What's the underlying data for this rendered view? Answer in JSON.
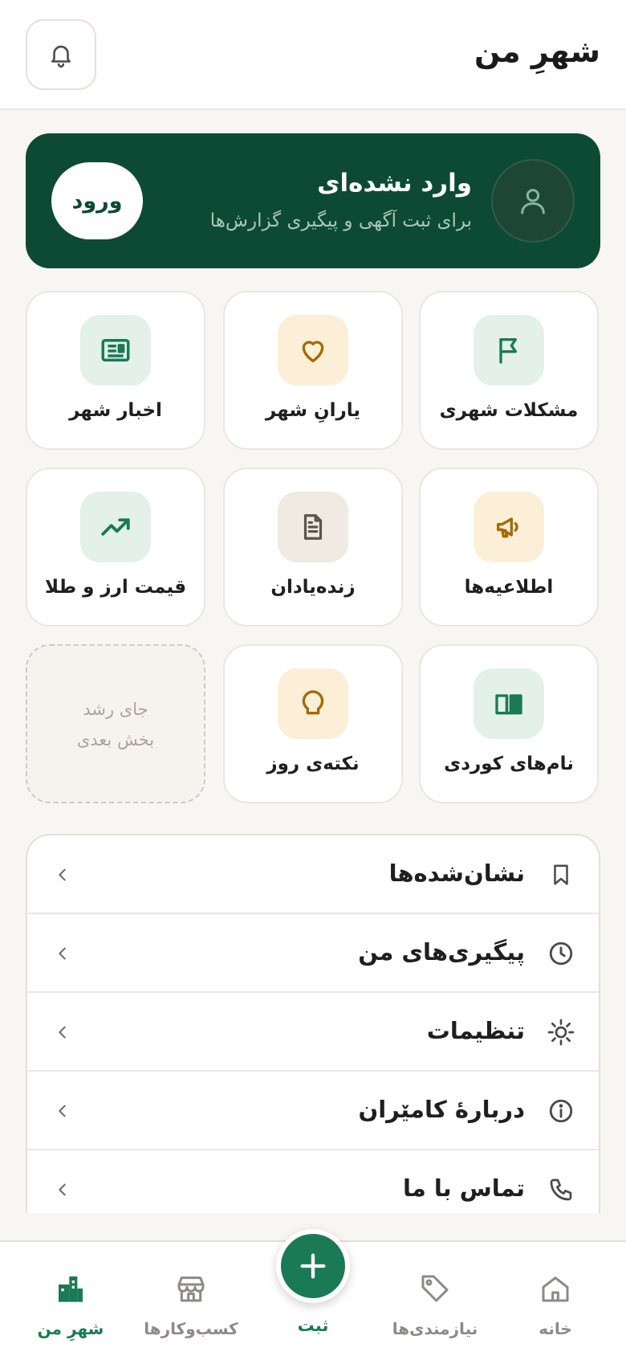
{
  "header": {
    "title": "شهرِ من"
  },
  "banner": {
    "title": "وارد نشده‌ای",
    "subtitle": "برای ثبت آگهی و پیگیری گزارش‌ها",
    "login_label": "ورود"
  },
  "tiles": [
    {
      "label": "مشکلات شهری",
      "icon": "flag-icon"
    },
    {
      "label": "یارانِ شهر",
      "icon": "heart-icon"
    },
    {
      "label": "اخبار شهر",
      "icon": "newspaper-icon"
    },
    {
      "label": "اطلاعیه‌ها",
      "icon": "megaphone-icon"
    },
    {
      "label": "زنده‌یادان",
      "icon": "document-icon"
    },
    {
      "label": "قیمت ارز و طلا",
      "icon": "trending-up-icon"
    },
    {
      "label": "نام‌های کوردی",
      "icon": "book-icon"
    },
    {
      "label": "نکته‌ی روز",
      "icon": "lightbulb-icon"
    }
  ],
  "placeholder_tile": {
    "line1": "جای رشد",
    "line2": "بخش بعدی"
  },
  "menu": [
    {
      "label": "نشان‌شده‌ها",
      "icon": "bookmark-icon"
    },
    {
      "label": "پیگیری‌های من",
      "icon": "clock-icon"
    },
    {
      "label": "تنظیمات",
      "icon": "sun-icon"
    },
    {
      "label": "دربارهٔ کامێران",
      "icon": "info-icon"
    },
    {
      "label": "تماس با ما",
      "icon": "phone-icon"
    }
  ],
  "bottom_nav": {
    "home": "خانه",
    "needs": "نیازمندی‌ها",
    "submit": "ثبت",
    "businesses": "کسب‌وکارها",
    "my_city": "شهرِ من"
  },
  "colors": {
    "brand": "#0d4a35",
    "accent": "#1a7a55",
    "orange": "#a56a00",
    "background": "#f8f6f2"
  }
}
